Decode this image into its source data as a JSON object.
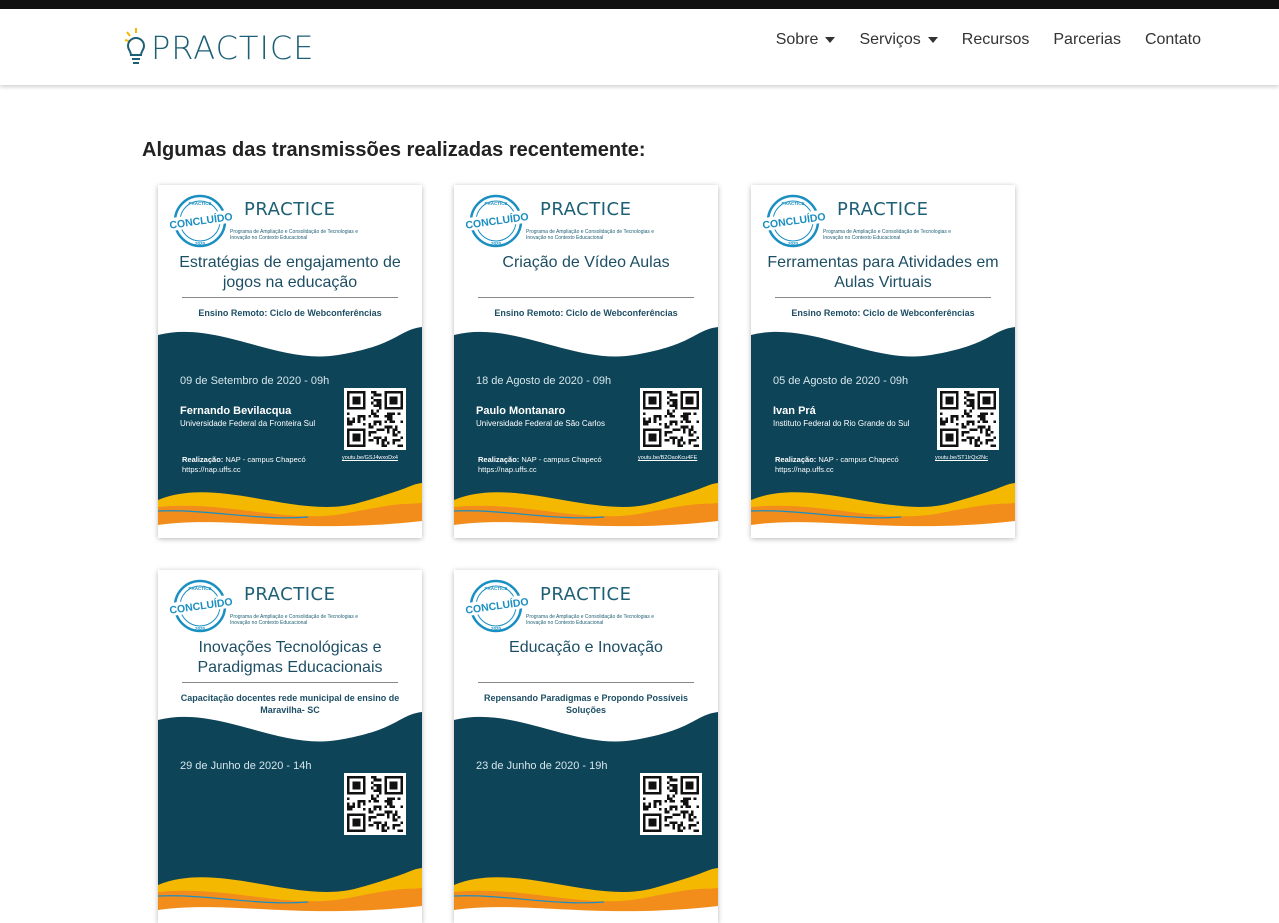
{
  "brand": {
    "logo_text": "PRACTICE",
    "color": "#1d5f75"
  },
  "nav": [
    {
      "label": "Sobre",
      "dropdown": true
    },
    {
      "label": "Serviços",
      "dropdown": true
    },
    {
      "label": "Recursos",
      "dropdown": false
    },
    {
      "label": "Parcerias",
      "dropdown": false
    },
    {
      "label": "Contato",
      "dropdown": false
    }
  ],
  "heading": "Algumas das transmissões realizadas recentemente:",
  "colors": {
    "navy": "#0d4458",
    "yellow": "#f5b800",
    "orange": "#f28c1a",
    "blue": "#1a8fc2"
  },
  "cards": [
    {
      "badge": "CONCLUÍDO",
      "badge_top": "PRACTICE",
      "badge_bottom": "2020",
      "brand": "PRACTICE",
      "brand_sub": "Programa de Ampliação e Consolidação de Tecnologias e Inovação no Contexto Educacional",
      "title": "Estratégias de engajamento de jogos na educação",
      "series": "Ensino Remoto: Ciclo de Webconferências",
      "date": "09 de Setembro de 2020 - 09h",
      "speaker": "Fernando Bevilacqua",
      "institution": "Universidade Federal da Fronteira Sul",
      "realizacao_label": "Realização:",
      "realizacao": "NAP - campus Chapecó",
      "site": "https://nap.uffs.cc",
      "link": "youtu.be/GSJ4wxoDx4"
    },
    {
      "badge": "CONCLUÍDO",
      "badge_top": "PRACTICE",
      "badge_bottom": "2020",
      "brand": "PRACTICE",
      "brand_sub": "Programa de Ampliação e Consolidação de Tecnologias e Inovação no Contexto Educacional",
      "title": "Criação de Vídeo Aulas",
      "series": "Ensino Remoto: Ciclo de Webconferências",
      "date": "18 de Agosto de 2020 - 09h",
      "speaker": "Paulo Montanaro",
      "institution": "Universidade Federal de São Carlos",
      "realizacao_label": "Realização:",
      "realizacao": "NAP - campus Chapecó",
      "site": "https://nap.uffs.cc",
      "link": "youtu.be/B2OaoKcu4FE"
    },
    {
      "badge": "CONCLUÍDO",
      "badge_top": "PRACTICE",
      "badge_bottom": "2020",
      "brand": "PRACTICE",
      "brand_sub": "Programa de Ampliação e Consolidação de Tecnologias e Inovação no Contexto Educacional",
      "title": "Ferramentas para Atividades em Aulas Virtuais",
      "series": "Ensino Remoto: Ciclo de Webconferências",
      "date": "05 de Agosto de 2020 - 09h",
      "speaker": "Ivan Prá",
      "institution": "Instituto Federal do Rio Grande do Sul",
      "realizacao_label": "Realização:",
      "realizacao": "NAP - campus Chapecó",
      "site": "https://nap.uffs.cc",
      "link": "youtu.be/ST1IrQx2Nc"
    },
    {
      "badge": "CONCLUÍDO",
      "badge_top": "PRACTICE",
      "badge_bottom": "2020",
      "brand": "PRACTICE",
      "brand_sub": "Programa de Ampliação e Consolidação de Tecnologias e Inovação no Contexto Educacional",
      "title": "Inovações Tecnológicas e Paradigmas Educacionais",
      "series": "Capacitação docentes rede municipal de ensino de Maravilha- SC",
      "date": "29 de Junho de 2020 - 14h",
      "speaker": "",
      "institution": "",
      "realizacao_label": "",
      "realizacao": "",
      "site": "",
      "link": ""
    },
    {
      "badge": "CONCLUÍDO",
      "badge_top": "PRACTICE",
      "badge_bottom": "2020",
      "brand": "PRACTICE",
      "brand_sub": "Programa de Ampliação e Consolidação de Tecnologias e Inovação no Contexto Educacional",
      "title": "Educação e Inovação",
      "series": "Repensando Paradigmas e Propondo Possíveis Soluções",
      "date": "23 de Junho de 2020 - 19h",
      "speaker": "",
      "institution": "",
      "realizacao_label": "",
      "realizacao": "",
      "site": "",
      "link": ""
    }
  ]
}
